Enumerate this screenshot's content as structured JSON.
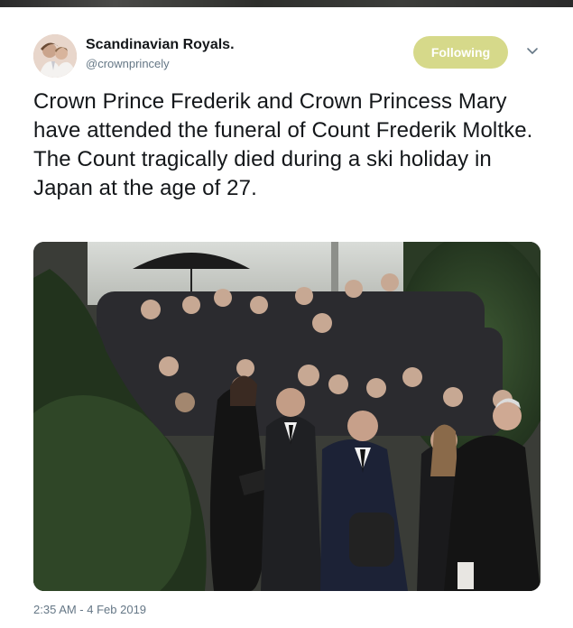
{
  "tweet": {
    "author_name": "Scandinavian Royals.",
    "author_handle": "@crownprincely",
    "follow_label": "Following",
    "text": "Crown Prince Frederik and Crown Princess Mary have attended the funeral of Count Frederik Moltke.\nThe Count tragically died during a ski holiday in Japan at the age of 27.",
    "timestamp": "2:35 AM - 4 Feb 2019"
  },
  "icons": {
    "caret": "chevron-down-icon",
    "avatar": "avatar-photo"
  },
  "colors": {
    "follow_button": "#d6d98a",
    "name": "#14171a",
    "secondary_text": "#657786"
  }
}
